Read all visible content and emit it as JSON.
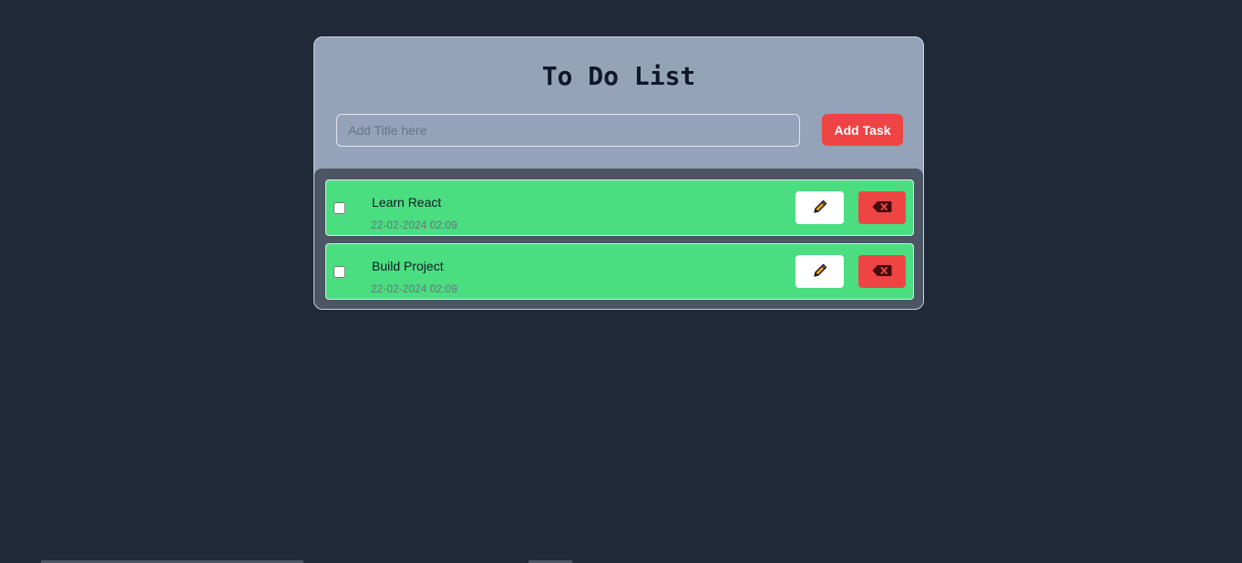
{
  "app": {
    "title": "To Do List"
  },
  "add_form": {
    "placeholder": "Add Title here",
    "value": "",
    "button_label": "Add Task"
  },
  "tasks": [
    {
      "title": "Learn React",
      "date": "22-02-2024 02:09",
      "completed": false
    },
    {
      "title": "Build Project",
      "date": "22-02-2024 02:09",
      "completed": false
    }
  ],
  "icons": {
    "edit": "pencil-icon",
    "delete": "backspace-x-icon"
  },
  "colors": {
    "background": "#1f2937",
    "card": "#94a3b8",
    "list_panel": "#4b5563",
    "task_item": "#4ade80",
    "accent_red": "#ef4444",
    "pencil": "#f59e0b"
  }
}
